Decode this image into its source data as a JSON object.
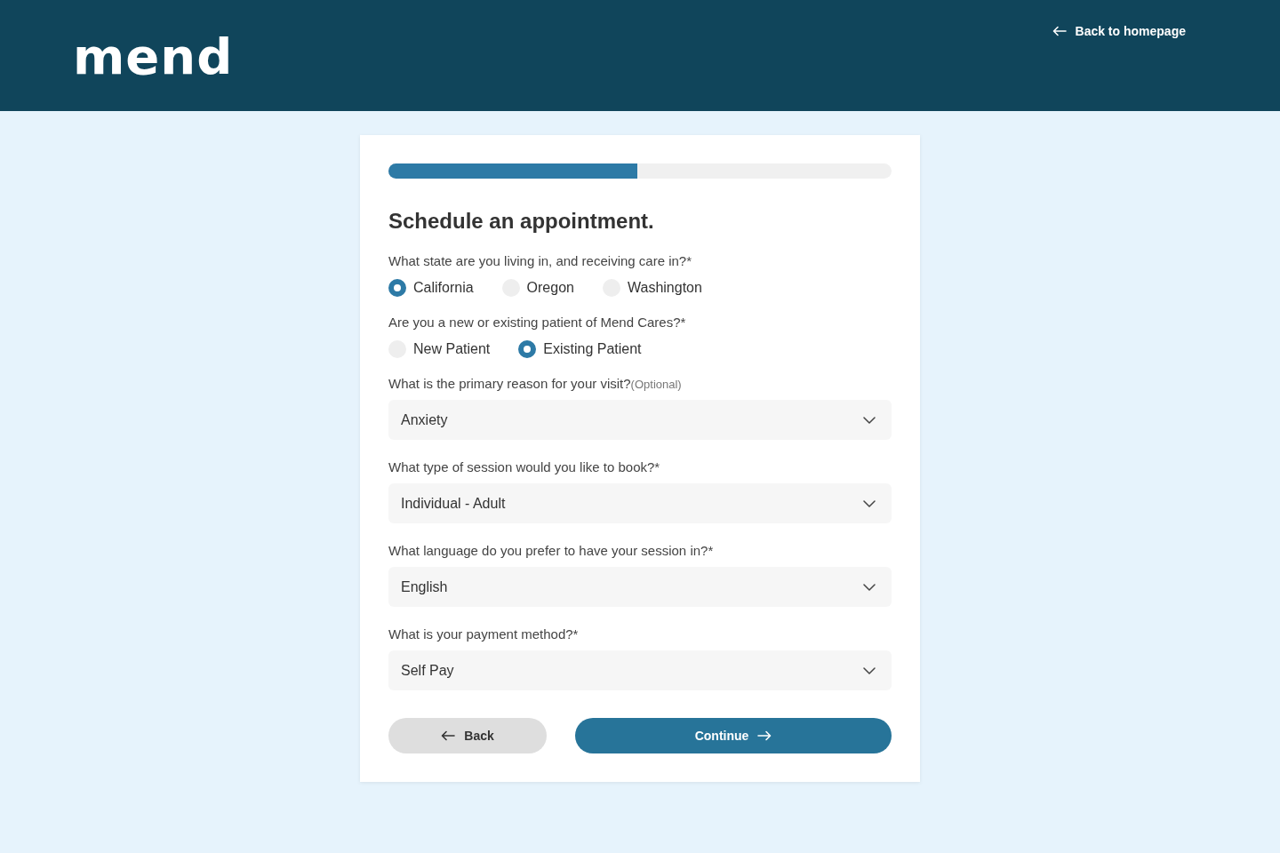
{
  "header": {
    "logo": "mend",
    "back_link": "Back to homepage"
  },
  "form": {
    "progress": {
      "level": 0.495
    },
    "title": "Schedule an appointment.",
    "radio_groups": [
      {
        "label": "What state are you living in, and receiving care in?*",
        "options": [
          {
            "label": "California",
            "selected": true
          },
          {
            "label": "Oregon",
            "selected": false
          },
          {
            "label": "Washington",
            "selected": false
          }
        ]
      },
      {
        "label": "Are you a new or existing patient of Mend Cares?*",
        "options": [
          {
            "label": "New Patient",
            "selected": false
          },
          {
            "label": "Existing Patient",
            "selected": true
          }
        ]
      }
    ],
    "selects": [
      {
        "label": "What is the primary reason for your visit?",
        "note": "(Optional)",
        "value": "Anxiety"
      },
      {
        "label": "What type of session would you like to book?*",
        "value": "Individual - Adult"
      },
      {
        "label": "What language do you prefer to have your session in?*",
        "value": "English"
      },
      {
        "label": "What is your payment method?*",
        "value": "Self Pay"
      }
    ],
    "buttons": {
      "back": "Back",
      "continue": "Continue"
    }
  }
}
